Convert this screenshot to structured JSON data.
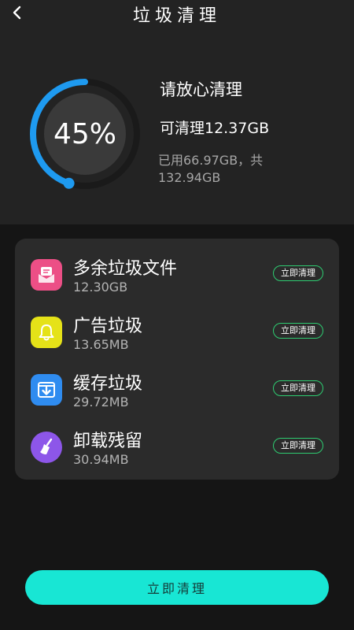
{
  "header": {
    "title": "垃圾清理",
    "back_icon": "chevron-left-icon"
  },
  "summary": {
    "percent_text": "45%",
    "percent_value": 45,
    "headline": "请放心清理",
    "cleanable": "可清理12.37GB",
    "usage": "已用66.97GB，共132.94GB"
  },
  "items": [
    {
      "name": "多余垃圾文件",
      "size": "12.30GB",
      "button": "立即清理",
      "icon": "mail-icon",
      "color": "#ec4f86"
    },
    {
      "name": "广告垃圾",
      "size": "13.65MB",
      "button": "立即清理",
      "icon": "bell-icon",
      "color": "#e5e218"
    },
    {
      "name": "缓存垃圾",
      "size": "29.72MB",
      "button": "立即清理",
      "icon": "download-icon",
      "color": "#2f8cf0"
    },
    {
      "name": "卸载残留",
      "size": "30.94MB",
      "button": "立即清理",
      "icon": "broom-icon",
      "color": "#8d56e9"
    }
  ],
  "action": {
    "label": "立即清理"
  },
  "colors": {
    "accent": "#18e6d4",
    "ring": "#1e9af0",
    "button_border": "#2ecc71"
  }
}
